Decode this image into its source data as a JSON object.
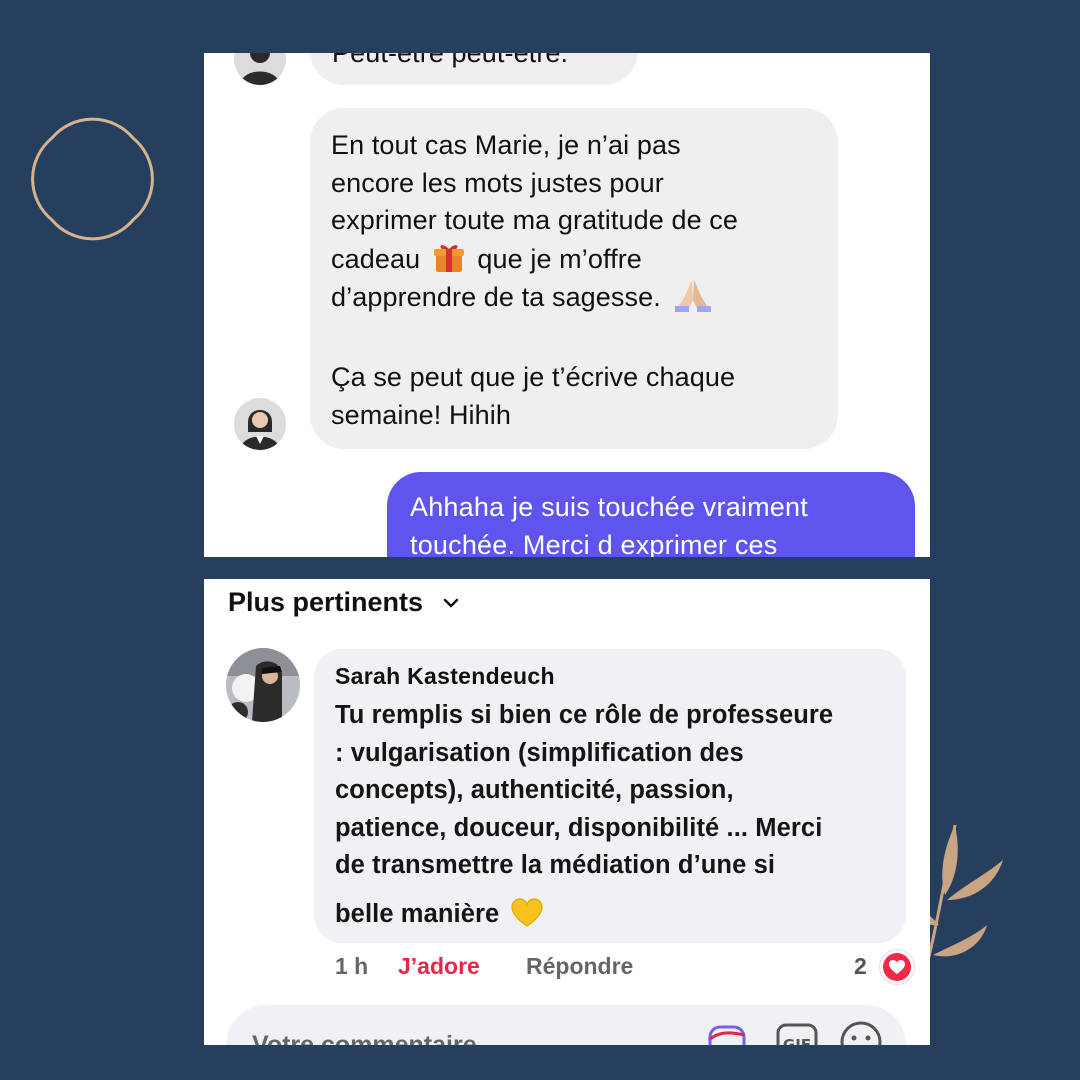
{
  "messenger": {
    "cut_message": "Peut-être peut-être.",
    "received_message": {
      "lines": [
        "En tout cas Marie, je n’ai pas",
        "encore les mots justes pour",
        "exprimer toute ma gratitude de ce"
      ],
      "line4_before": "cadeau",
      "line4_after": "que je m’offre",
      "line5": "d’apprendre de ta sagesse.",
      "line6": "Ça se peut que je t’écrive chaque",
      "line7": "semaine! Hihih"
    },
    "sent_message": {
      "line1": "Ahhaha je suis touchée vraiment",
      "line2": "touchée. Merci d exprimer ces"
    },
    "emojis": [
      "gift-emoji",
      "folded-hands-emoji"
    ]
  },
  "comments": {
    "sort_label": "Plus pertinents",
    "comment": {
      "author": "Sarah Kastendeuch",
      "lines": [
        "Tu remplis si bien ce rôle de professeure",
        ": vulgarisation (simplification des",
        "concepts), authenticité, passion,",
        "patience, douceur, disponibilité ... Merci",
        "de transmettre la médiation d’une si"
      ],
      "last_line": "belle manière",
      "emoji": "yellow-heart-emoji",
      "time": "1 h",
      "like_label": "J’adore",
      "reply_label": "Répondre",
      "reaction_count": "2",
      "reaction_icon": "love-reaction-icon"
    },
    "composer_placeholder": "Votre commentaire"
  },
  "colors": {
    "background": "#263f5e",
    "ornament": "#d7b28e",
    "sent_bubble": "#5f55ee",
    "received_bubble": "#efefef",
    "like_active": "#e0294a"
  }
}
